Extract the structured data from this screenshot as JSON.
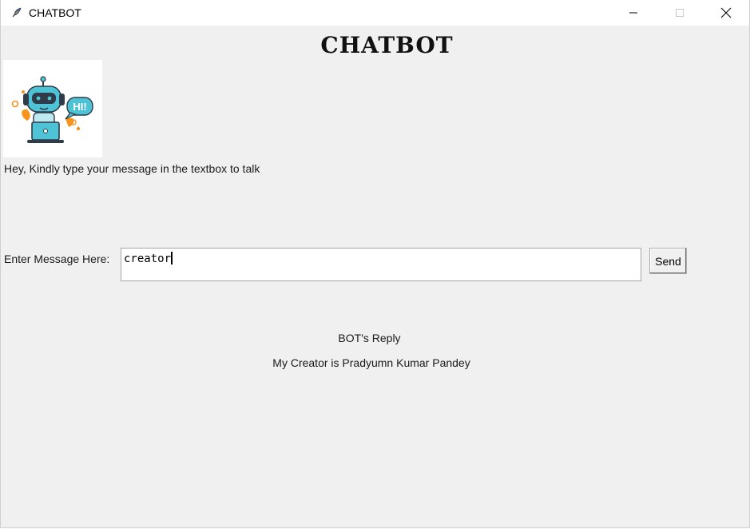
{
  "window": {
    "title": "CHATBOT",
    "controls": [
      "minimize",
      "maximize",
      "close"
    ]
  },
  "header": {
    "heading": "CHATBOT"
  },
  "bot": {
    "image_icon": "robot-waving-hi-icon",
    "image_bubble_text": "HI!",
    "greeting": "Hey, Kindly type your message in the textbox to talk"
  },
  "input": {
    "label": "Enter Message Here:",
    "value": "creator",
    "send_label": "Send"
  },
  "reply": {
    "title": "BOT's Reply",
    "text": "My Creator is Pradyumn Kumar Pandey"
  },
  "colors": {
    "window_bg": "#f0f0f0",
    "titlebar_bg": "#ffffff",
    "robot_teal": "#4fc3d6",
    "robot_orange": "#f7941d"
  }
}
